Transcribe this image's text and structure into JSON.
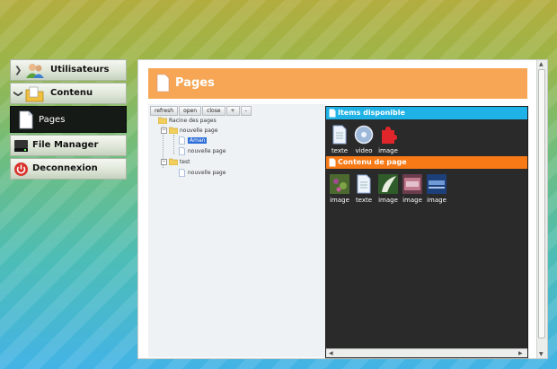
{
  "sidebar": {
    "items": [
      {
        "label": "Utilisateurs"
      },
      {
        "label": "Contenu"
      },
      {
        "label": "Pages"
      },
      {
        "label": "File Manager"
      },
      {
        "label": "Deconnexion"
      }
    ]
  },
  "main": {
    "title": "Pages",
    "toolbar": {
      "refresh": "refresh",
      "open": "open",
      "close": "close",
      "add": "+",
      "remove": "-"
    },
    "tree": {
      "root": "Racine des pages",
      "nodes": [
        "nouvelle page",
        "Aman",
        "nouvelle page",
        "test",
        "nouvelle page"
      ]
    },
    "available": {
      "title": "Items disponible",
      "items": [
        "texte",
        "video",
        "image"
      ]
    },
    "content": {
      "title": "Contenu de page",
      "items": [
        "image",
        "texte",
        "image",
        "image",
        "image"
      ]
    }
  },
  "colors": {
    "header_orange": "#f6a654",
    "available_blue": "#1fb2e6",
    "content_orange": "#f77a17",
    "selection_blue": "#2f6ed8"
  }
}
